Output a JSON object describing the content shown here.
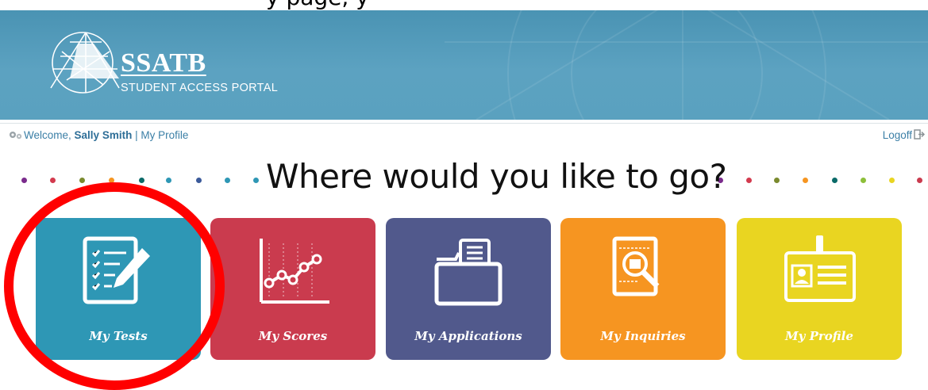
{
  "cropped_heading": "y              page,        y",
  "brand": {
    "name": "SSATB",
    "subtitle": "STUDENT ACCESS PORTAL"
  },
  "topbar": {
    "welcome_prefix": "Welcome,",
    "user_name": "Sally Smith",
    "separator": "|",
    "profile_link": "My Profile",
    "logoff": "Logoff"
  },
  "heading": "Where would you like to go?",
  "tiles": [
    {
      "label": "My Tests",
      "color": "#2e97b5",
      "icon": "checklist-icon"
    },
    {
      "label": "My Scores",
      "color": "#ca3b4e",
      "icon": "line-chart-icon"
    },
    {
      "label": "My Applications",
      "color": "#51598c",
      "icon": "folder-icon"
    },
    {
      "label": "My Inquiries",
      "color": "#f69521",
      "icon": "magnifier-document-icon"
    },
    {
      "label": "My Profile",
      "color": "#e9d521",
      "icon": "id-badge-icon"
    }
  ],
  "dot_colors": [
    "#7a2b8c",
    "#d33a4e",
    "#7a8a2e",
    "#f69521",
    "#0a6a68",
    "#2e97b5",
    "#3b5a9a",
    "#2e97b5",
    "#2e97b5"
  ],
  "dot_colors_right": [
    "#7a2b8c",
    "#d33a4e",
    "#7a8a2e",
    "#f69521",
    "#0a6a68",
    "#8dbf3a",
    "#e9d521",
    "#ca3b4e",
    "#7a2b8c"
  ],
  "annotation_color": "#ff0000"
}
